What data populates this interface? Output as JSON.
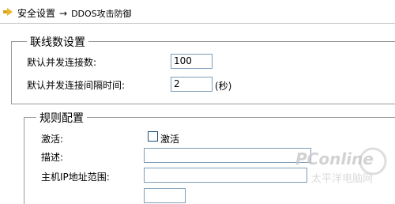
{
  "breadcrumb": {
    "section": "安全设置",
    "arrow": "→",
    "current": "DDOS攻击防御"
  },
  "connections_group": {
    "legend": "联线数设置",
    "default_concurrent_label": "默认并发连接数:",
    "default_concurrent_value": "100",
    "interval_label": "默认并发连接间隔时间:",
    "interval_value": "2",
    "interval_unit": "(秒)"
  },
  "rules_group": {
    "legend": "规则配置",
    "activate_label": "激活:",
    "activate_checkbox_label": "激活",
    "activate_checked": false,
    "description_label": "描述:",
    "description_value": "",
    "ip_range_label": "主机IP地址范围:",
    "ip_range_value": ""
  },
  "watermark": {
    "brand": "PConline",
    "tagline": "太平洋电脑网"
  }
}
